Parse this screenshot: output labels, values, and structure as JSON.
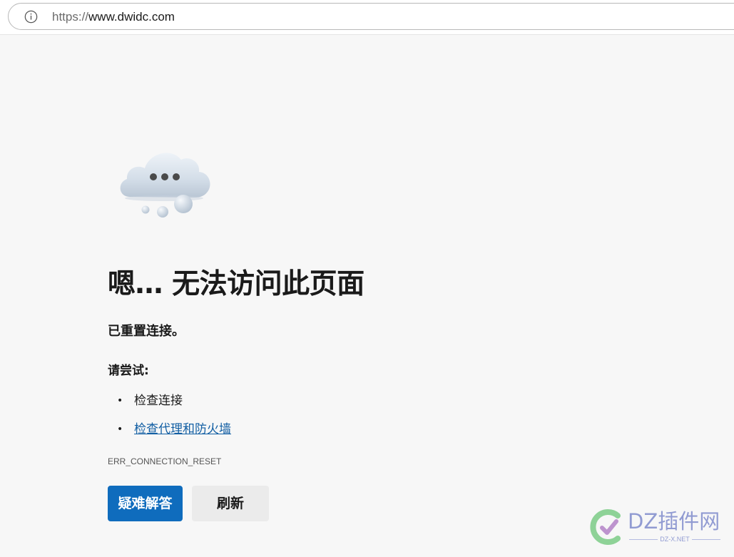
{
  "address_bar": {
    "url_scheme": "https://",
    "url_host": "www.dwidc.com",
    "info_icon": "info-icon"
  },
  "illustration": {
    "icon": "cloud-ellipsis-icon"
  },
  "error_page": {
    "title": "嗯… 无法访问此页面",
    "summary": "已重置连接。",
    "try_heading": "请尝试:",
    "suggestions": [
      {
        "text": "检查连接",
        "is_link": false
      },
      {
        "text": "检查代理和防火墙",
        "is_link": true
      }
    ],
    "error_code": "ERR_CONNECTION_RESET"
  },
  "buttons": {
    "troubleshoot_label": "疑难解答",
    "refresh_label": "刷新"
  },
  "watermark": {
    "main": "DZ插件网",
    "sub": "DZ-X.NET"
  },
  "colors": {
    "page_background": "#f7f7f7",
    "primary_button": "#0f6cbd",
    "link": "#115ea3",
    "secondary_button": "#ebebeb"
  }
}
